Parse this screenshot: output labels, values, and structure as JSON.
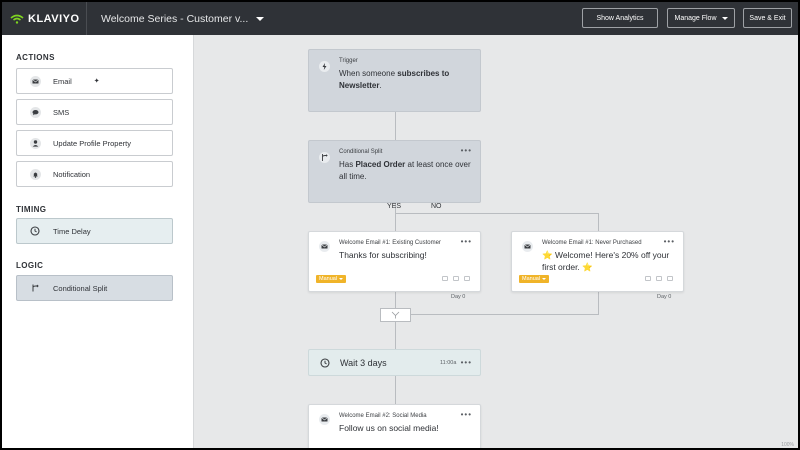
{
  "app": {
    "brand": "KLAVIYO",
    "flow_title": "Welcome Series - Customer v..."
  },
  "toolbar": {
    "show_analytics": "Show Analytics",
    "manage_flow": "Manage Flow",
    "save_exit": "Save & Exit"
  },
  "sidebar": {
    "actions_title": "ACTIONS",
    "actions": [
      {
        "label": "Email",
        "icon": "envelope-icon"
      },
      {
        "label": "SMS",
        "icon": "chat-bubble-icon"
      },
      {
        "label": "Update Profile Property",
        "icon": "person-icon"
      },
      {
        "label": "Notification",
        "icon": "bell-icon"
      }
    ],
    "timing_title": "TIMING",
    "timing": [
      {
        "label": "Time Delay",
        "icon": "clock-icon"
      }
    ],
    "logic_title": "LOGIC",
    "logic": [
      {
        "label": "Conditional Split",
        "icon": "split-icon"
      }
    ]
  },
  "flow": {
    "trigger": {
      "label": "Trigger",
      "text_pre": "When someone ",
      "text_bold": "subscribes to Newsletter",
      "text_post": "."
    },
    "split": {
      "label": "Conditional Split",
      "text_pre": "Has ",
      "text_bold": "Placed Order",
      "text_post": " at least once over all time."
    },
    "yes_label": "YES",
    "no_label": "NO",
    "email_yes": {
      "label": "Welcome Email #1: Existing Customer",
      "text": "Thanks for subscribing!",
      "badge": "Manual",
      "day": "Day 0"
    },
    "email_no": {
      "label": "Welcome Email #1: Never Purchased",
      "text": "⭐ Welcome! Here's 20% off your first order. ⭐",
      "badge": "Manual",
      "day": "Day 0"
    },
    "delay": {
      "text": "Wait 3 days",
      "time": "11:00a"
    },
    "email_social": {
      "label": "Welcome Email #2: Social Media",
      "text": "Follow us on social media!"
    },
    "zoom": "100%"
  },
  "colors": {
    "topbar": "#2f3237",
    "canvas": "#e7e8e9",
    "badge": "#f0b429",
    "brand_green": "#7ed321"
  }
}
